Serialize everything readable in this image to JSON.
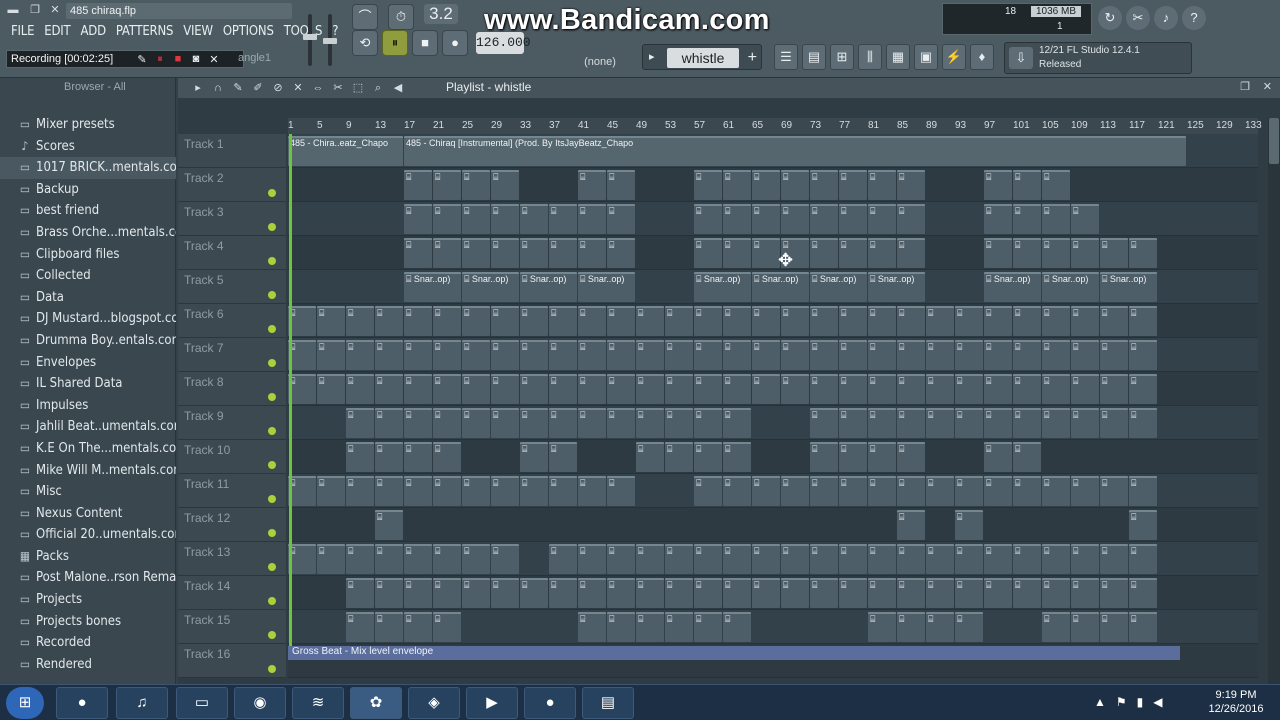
{
  "window": {
    "filename": "485 chiraq.flp",
    "menu": [
      "FILE",
      "EDIT",
      "ADD",
      "PATTERNS",
      "VIEW",
      "OPTIONS",
      "TOOLS",
      "?"
    ]
  },
  "recording": {
    "text": "Recording [00:02:25]",
    "angle_label": "angle1"
  },
  "transport": {
    "pattern_number": "3.2",
    "tempo": "126.000",
    "snap": "(none)"
  },
  "watermark": "www.Bandicam.com",
  "pattern": {
    "name": "whistle",
    "plus": "+"
  },
  "cpu": {
    "cpu": "18",
    "memory": "1036 MB",
    "poly": "1"
  },
  "update": {
    "line1": "12/21  FL Studio 12.4.1",
    "line2": "Released"
  },
  "browser": {
    "header": "Browser - All",
    "items": [
      {
        "label": "Mixer presets",
        "icon": "folder"
      },
      {
        "label": "Scores",
        "icon": "note"
      },
      {
        "label": "1017 BRICK..mentals.com)",
        "icon": "folder",
        "selected": true
      },
      {
        "label": "Backup",
        "icon": "folder"
      },
      {
        "label": "best friend",
        "icon": "folder"
      },
      {
        "label": "Brass Orche...mentals.com)",
        "icon": "folder"
      },
      {
        "label": "Clipboard files",
        "icon": "folder"
      },
      {
        "label": "Collected",
        "icon": "folder"
      },
      {
        "label": "Data",
        "icon": "folder"
      },
      {
        "label": "DJ Mustard...blogspot.com",
        "icon": "folder"
      },
      {
        "label": "Drumma Boy..entals.com)",
        "icon": "folder"
      },
      {
        "label": "Envelopes",
        "icon": "folder"
      },
      {
        "label": "IL Shared Data",
        "icon": "folder"
      },
      {
        "label": "Impulses",
        "icon": "folder"
      },
      {
        "label": "Jahlil Beat..umentals.com)",
        "icon": "folder"
      },
      {
        "label": "K.E On The...mentals.com)",
        "icon": "folder"
      },
      {
        "label": "Mike Will M..mentals.com)",
        "icon": "folder"
      },
      {
        "label": "Misc",
        "icon": "folder"
      },
      {
        "label": "Nexus Content",
        "icon": "folder"
      },
      {
        "label": "Official 20..umentals.com)",
        "icon": "folder"
      },
      {
        "label": "Packs",
        "icon": "pack"
      },
      {
        "label": "Post Malone..rson Remake",
        "icon": "folder"
      },
      {
        "label": "Projects",
        "icon": "folder"
      },
      {
        "label": "Projects bones",
        "icon": "folder"
      },
      {
        "label": "Recorded",
        "icon": "folder"
      },
      {
        "label": "Rendered",
        "icon": "folder"
      }
    ]
  },
  "playlist": {
    "title": "Playlist - whistle",
    "bar_numbers": [
      "1",
      "5",
      "9",
      "13",
      "17",
      "21",
      "25",
      "29",
      "33",
      "37",
      "41",
      "45",
      "49",
      "53",
      "57",
      "61",
      "65",
      "69",
      "73",
      "77",
      "81",
      "85",
      "89",
      "93",
      "97",
      "101",
      "105",
      "109",
      "113",
      "117",
      "121",
      "125",
      "129",
      "133"
    ],
    "tracks": [
      "Track 1",
      "Track 2",
      "Track 3",
      "Track 4",
      "Track 5",
      "Track 6",
      "Track 7",
      "Track 8",
      "Track 9",
      "Track 10",
      "Track 11",
      "Track 12",
      "Track 13",
      "Track 14",
      "Track 15",
      "Track 16"
    ],
    "audio_clip_1": "485 - Chira..eatz_Chapo",
    "audio_clip_2": "485 - Chiraq [Instrumental] (Prod. By ItsJayBeatz_Chapo",
    "snare_label": "Snar..op)",
    "envelope_label": "Gross Beat - Mix level envelope"
  },
  "taskbar": {
    "time": "9:19 PM",
    "date": "12/26/2016"
  }
}
